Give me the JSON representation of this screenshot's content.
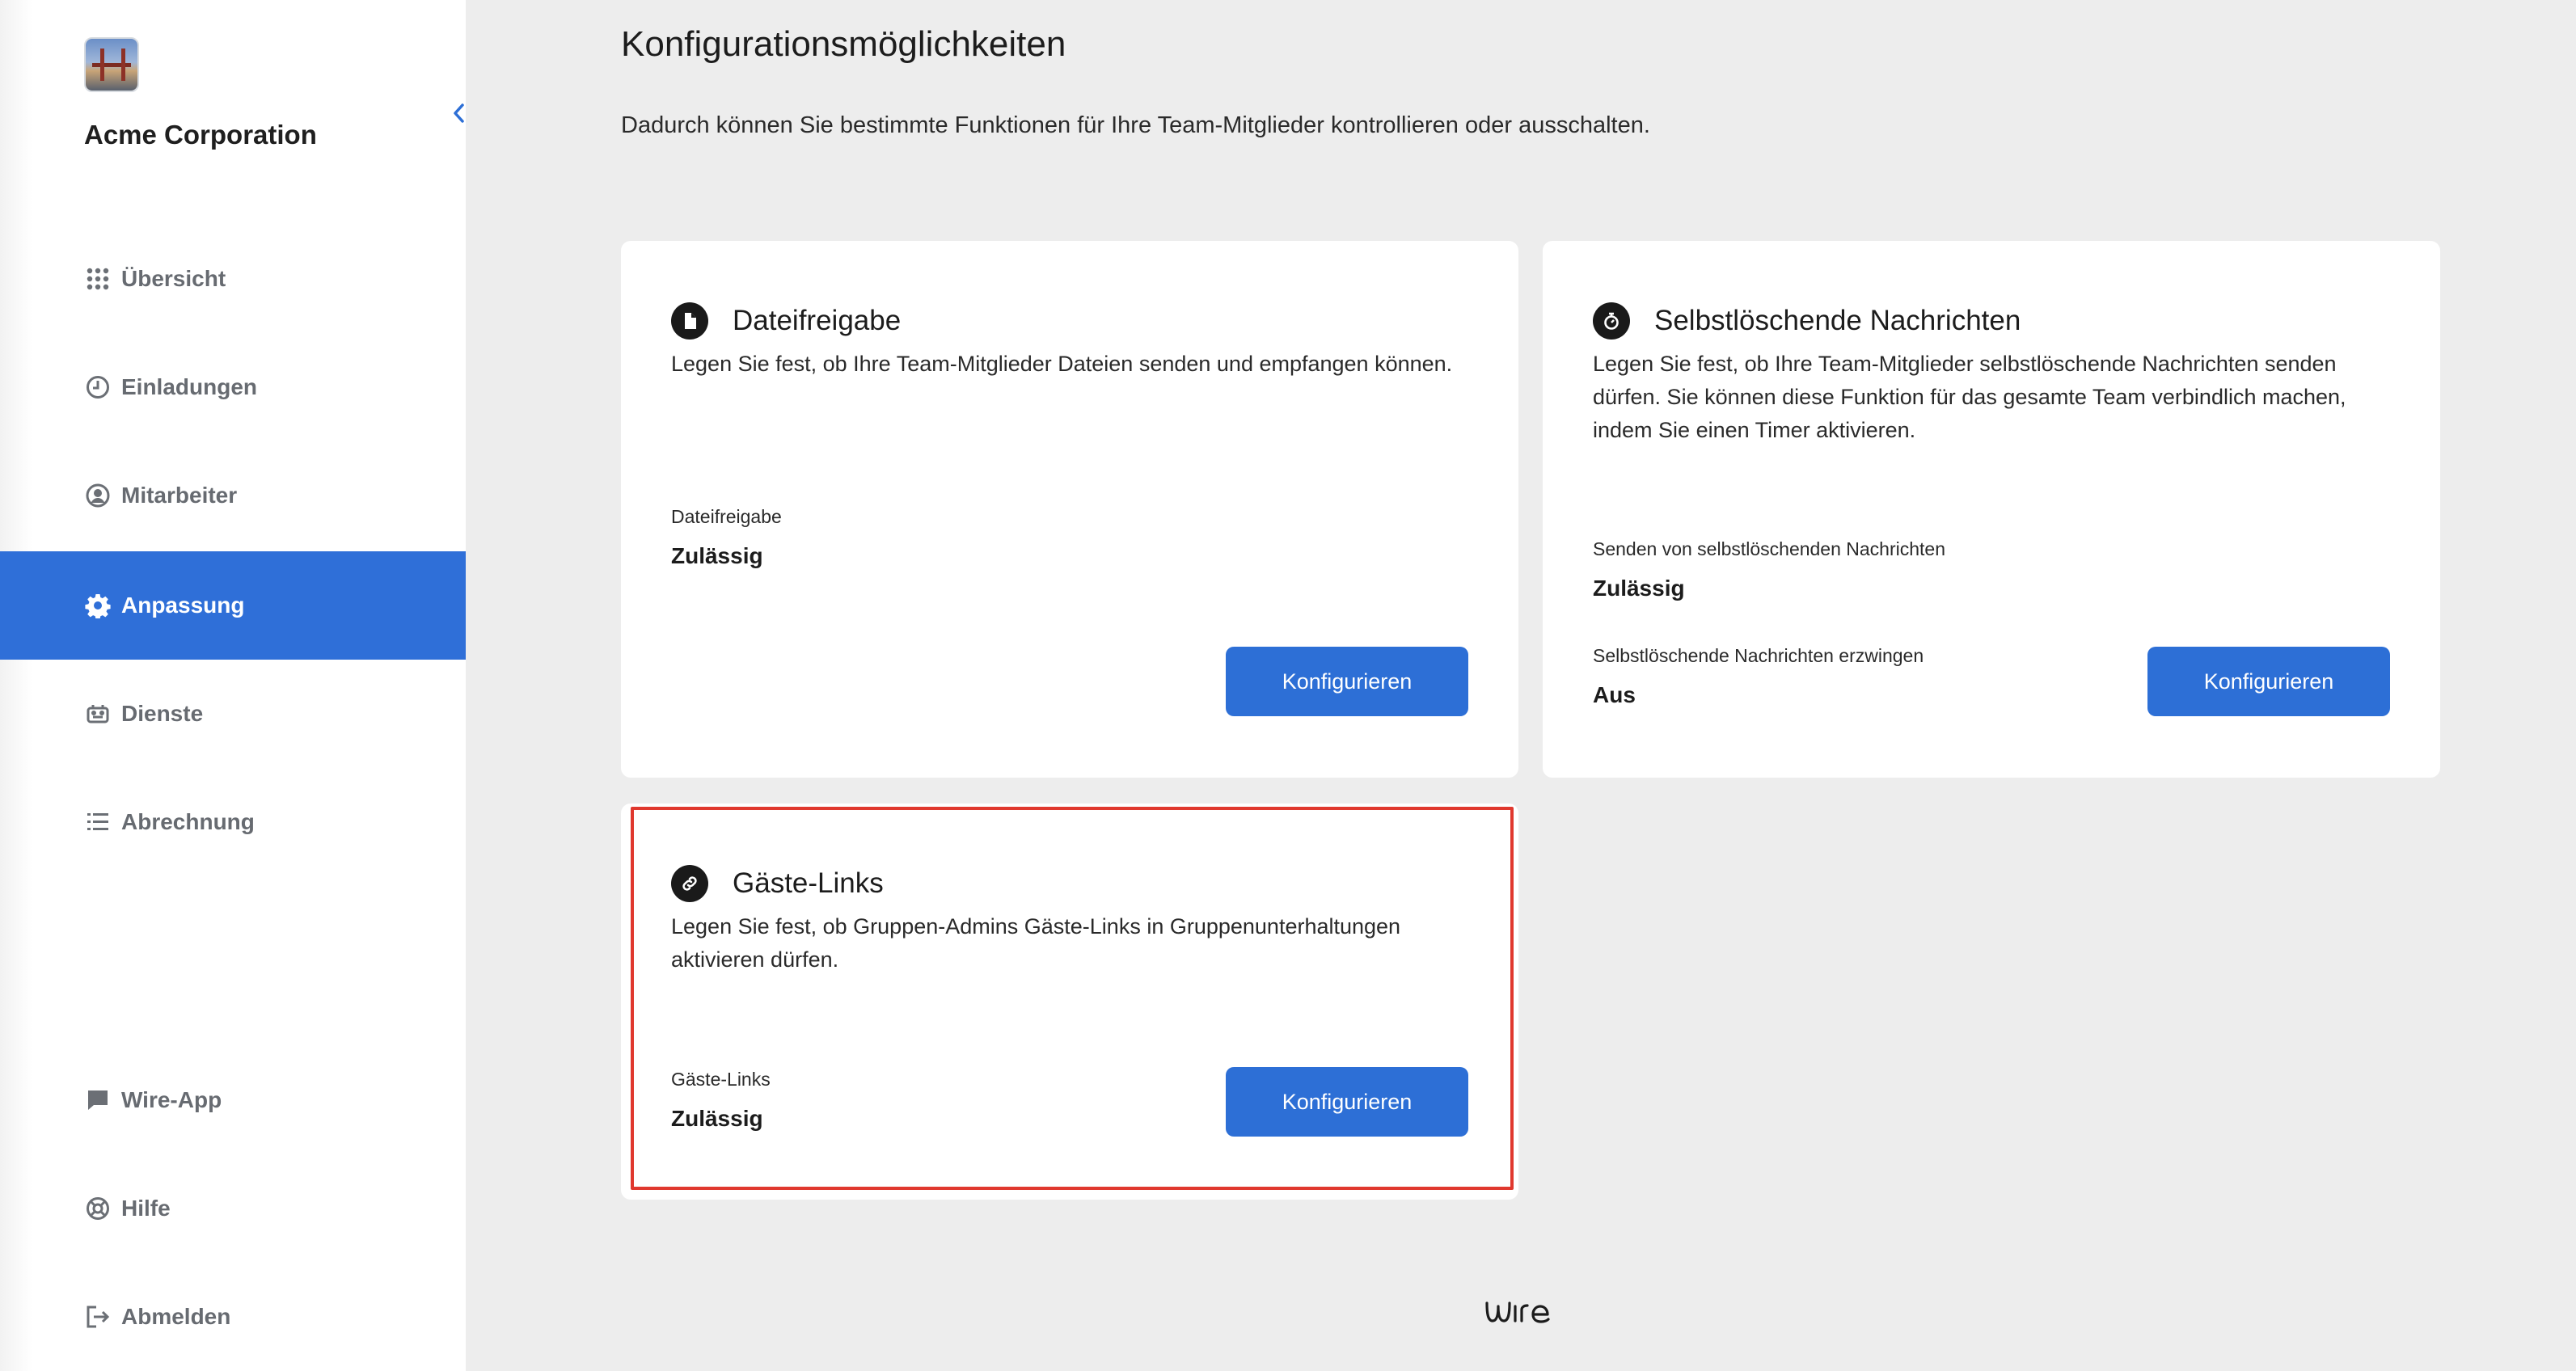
{
  "sidebar": {
    "org_name": "Acme Corporation",
    "items": [
      {
        "label": "Übersicht",
        "icon": "grid-icon"
      },
      {
        "label": "Einladungen",
        "icon": "clock-icon"
      },
      {
        "label": "Mitarbeiter",
        "icon": "user-circle-icon"
      },
      {
        "label": "Anpassung",
        "icon": "gear-icon",
        "active": true
      },
      {
        "label": "Dienste",
        "icon": "bot-icon"
      },
      {
        "label": "Abrechnung",
        "icon": "list-icon"
      },
      {
        "label": "Wire-App",
        "icon": "chat-bubble-icon"
      },
      {
        "label": "Hilfe",
        "icon": "lifebuoy-icon"
      },
      {
        "label": "Abmelden",
        "icon": "logout-icon"
      }
    ]
  },
  "main": {
    "title": "Konfigurationsmöglichkeiten",
    "description": "Dadurch können Sie bestimmte Funktionen für Ihre Team-Mitglieder kontrollieren oder ausschalten.",
    "cards": [
      {
        "title": "Dateifreigabe",
        "icon": "file-icon",
        "description": "Legen Sie fest, ob Ihre Team-Mitglieder Dateien senden und empfangen können.",
        "fields": [
          {
            "label": "Dateifreigabe",
            "value": "Zulässig"
          }
        ],
        "button": "Konfigurieren"
      },
      {
        "title": "Selbstlöschende Nachrichten",
        "icon": "timer-icon",
        "description": "Legen Sie fest, ob Ihre Team-Mitglieder selbstlöschende Nachrichten senden dürfen. Sie können diese Funktion für das gesamte Team verbindlich machen, indem Sie einen Timer aktivieren.",
        "fields": [
          {
            "label": "Senden von selbstlöschenden Nachrichten",
            "value": "Zulässig"
          },
          {
            "label": "Selbstlöschende Nachrichten erzwingen",
            "value": "Aus"
          }
        ],
        "button": "Konfigurieren"
      },
      {
        "title": "Gäste-Links",
        "icon": "link-icon",
        "description": "Legen Sie fest, ob Gruppen-Admins Gäste-Links in Gruppenunterhaltungen aktivieren dürfen.",
        "fields": [
          {
            "label": "Gäste-Links",
            "value": "Zulässig"
          }
        ],
        "button": "Konfigurieren"
      }
    ]
  },
  "colors": {
    "accent": "#2d6fd6",
    "active_nav": "#2f6fd8",
    "highlight": "#e0382e",
    "background": "#ededed"
  },
  "footer": {
    "logo": "wire-logo"
  }
}
